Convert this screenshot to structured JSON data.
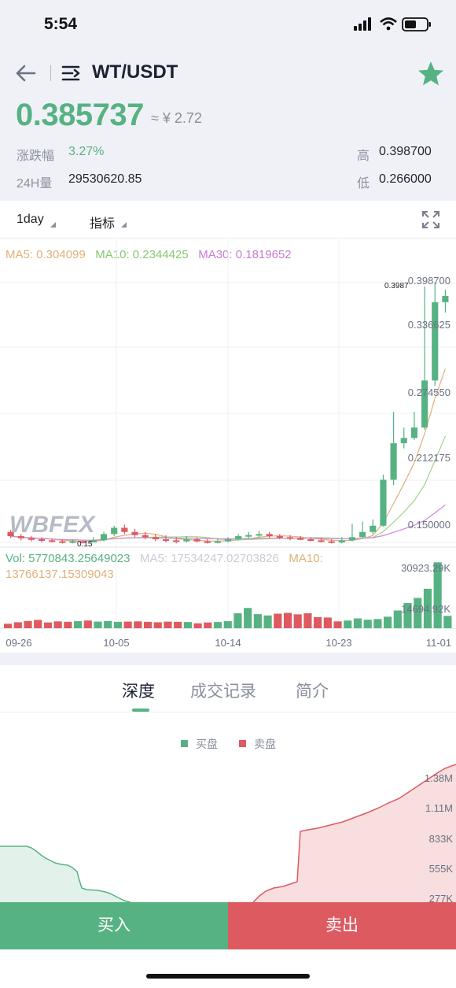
{
  "status_bar": {
    "time": "5:54"
  },
  "header": {
    "title": "WT/USDT"
  },
  "ticker": {
    "price": "0.385737",
    "cny": "≈ ¥ 2.72",
    "change_label": "涨跌幅",
    "change_value": "3.27%",
    "high_label": "高",
    "high_value": "0.398700",
    "volume_label": "24H量",
    "volume_value": "29530620.85",
    "low_label": "低",
    "low_value": "0.266000"
  },
  "toolbar": {
    "interval": "1day",
    "indicator": "指标"
  },
  "chart": {
    "ma5": "MA5: 0.304099",
    "ma10": "MA10: 0.2344425",
    "ma30": "MA30: 0.1819652",
    "vol_line": "Vol: 5770843.25649023",
    "vol_ma5": "MA5: 17534247.02703826",
    "vol_ma10_a": "MA10:",
    "vol_ma10_b": "13766137.15309043",
    "price_axis": [
      "0.398700",
      "0.336625",
      "0.274550",
      "0.212175",
      "0.150000"
    ],
    "max_label": "0.3987",
    "min_label": "0.15",
    "vol_axis": [
      "30923.29K",
      "14694.92K"
    ],
    "dates": [
      "09-26",
      "10-05",
      "10-14",
      "10-23",
      "11-01"
    ],
    "watermark": "WBFEX",
    "colors": {
      "up": "#57b283",
      "down": "#dd5a61",
      "ma5": "#e0b17a",
      "ma10": "#9fd38a",
      "ma30": "#cf87d7"
    }
  },
  "chart_data": {
    "type": "candlestick",
    "interval": "1day",
    "categories": [
      "09-26",
      "10-05",
      "10-14",
      "10-23",
      "11-01"
    ],
    "candles": [
      [
        0.16,
        0.156,
        0.162,
        0.154
      ],
      [
        0.156,
        0.154,
        0.158,
        0.152
      ],
      [
        0.154,
        0.153,
        0.156,
        0.151
      ],
      [
        0.153,
        0.152,
        0.155,
        0.15
      ],
      [
        0.152,
        0.151,
        0.154,
        0.15
      ],
      [
        0.151,
        0.15,
        0.153,
        0.149
      ],
      [
        0.15,
        0.151,
        0.153,
        0.149
      ],
      [
        0.151,
        0.15,
        0.152,
        0.149
      ],
      [
        0.15,
        0.152,
        0.155,
        0.15
      ],
      [
        0.152,
        0.158,
        0.16,
        0.151
      ],
      [
        0.158,
        0.164,
        0.166,
        0.156
      ],
      [
        0.164,
        0.16,
        0.167,
        0.158
      ],
      [
        0.16,
        0.157,
        0.163,
        0.155
      ],
      [
        0.157,
        0.155,
        0.16,
        0.153
      ],
      [
        0.155,
        0.153,
        0.158,
        0.151
      ],
      [
        0.153,
        0.152,
        0.157,
        0.15
      ],
      [
        0.152,
        0.151,
        0.155,
        0.149
      ],
      [
        0.151,
        0.153,
        0.156,
        0.15
      ],
      [
        0.153,
        0.151,
        0.155,
        0.15
      ],
      [
        0.151,
        0.15,
        0.153,
        0.149
      ],
      [
        0.15,
        0.151,
        0.154,
        0.149
      ],
      [
        0.151,
        0.153,
        0.155,
        0.15
      ],
      [
        0.153,
        0.156,
        0.158,
        0.152
      ],
      [
        0.156,
        0.157,
        0.16,
        0.154
      ],
      [
        0.157,
        0.158,
        0.161,
        0.155
      ],
      [
        0.158,
        0.156,
        0.16,
        0.154
      ],
      [
        0.156,
        0.155,
        0.158,
        0.153
      ],
      [
        0.155,
        0.154,
        0.157,
        0.152
      ],
      [
        0.154,
        0.153,
        0.156,
        0.152
      ],
      [
        0.153,
        0.152,
        0.155,
        0.151
      ],
      [
        0.152,
        0.151,
        0.154,
        0.15
      ],
      [
        0.151,
        0.15,
        0.153,
        0.149
      ],
      [
        0.15,
        0.152,
        0.155,
        0.149
      ],
      [
        0.152,
        0.155,
        0.168,
        0.151
      ],
      [
        0.155,
        0.16,
        0.17,
        0.154
      ],
      [
        0.16,
        0.166,
        0.172,
        0.158
      ],
      [
        0.166,
        0.21,
        0.215,
        0.165
      ],
      [
        0.21,
        0.245,
        0.275,
        0.205
      ],
      [
        0.245,
        0.25,
        0.26,
        0.24
      ],
      [
        0.25,
        0.26,
        0.275,
        0.248
      ],
      [
        0.26,
        0.305,
        0.395,
        0.258
      ],
      [
        0.305,
        0.38,
        0.3987,
        0.3
      ],
      [
        0.38,
        0.386,
        0.392,
        0.37
      ]
    ],
    "volume": [
      2.1,
      2.8,
      3.4,
      3.9,
      2.7,
      3.2,
      3.0,
      3.3,
      3.6,
      3.1,
      3.4,
      3.0,
      3.1,
      3.2,
      3.0,
      2.8,
      3.1,
      3.0,
      2.9,
      2.3,
      2.7,
      2.9,
      3.3,
      7.0,
      9.5,
      6.6,
      6.0,
      6.8,
      7.2,
      6.5,
      7.0,
      5.2,
      5.0,
      3.2,
      3.6,
      4.6,
      4.0,
      4.3,
      5.4,
      8.3,
      11.8,
      14.2,
      18.5,
      30.9,
      5.8
    ],
    "volume_unit": "M",
    "ylim": [
      0.15,
      0.3987
    ]
  },
  "tabs": [
    {
      "label": "深度"
    },
    {
      "label": "成交记录"
    },
    {
      "label": "简介"
    }
  ],
  "depth": {
    "legend_buy": "买盘",
    "legend_sell": "卖盘",
    "axis": [
      "1.38M",
      "1.11M",
      "833K",
      "555K",
      "277K"
    ]
  },
  "actions": {
    "buy": "买入",
    "sell": "卖出"
  }
}
